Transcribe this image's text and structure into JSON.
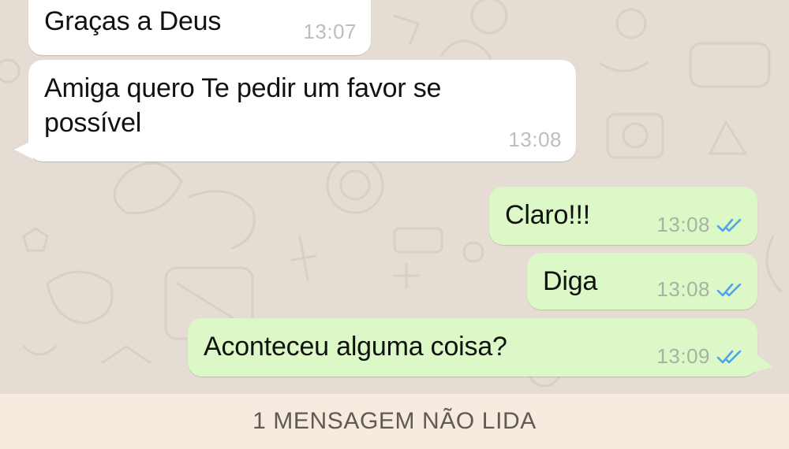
{
  "messages": [
    {
      "direction": "incoming",
      "text": "Graças a Deus",
      "time": "13:07"
    },
    {
      "direction": "incoming",
      "text_line1": "Amiga quero Te pedir um favor se",
      "text_line2": "possível",
      "time": "13:08"
    },
    {
      "direction": "outgoing",
      "text": "Claro!!!",
      "time": "13:08",
      "status": "read-double-check-icon"
    },
    {
      "direction": "outgoing",
      "text": "Diga",
      "time": "13:08",
      "status": "read-double-check-icon"
    },
    {
      "direction": "outgoing",
      "text": "Aconteceu alguma coisa?",
      "time": "13:09",
      "status": "read-double-check-icon"
    }
  ],
  "unread_banner": {
    "label": "1 MENSAGEM NÃO LIDA"
  },
  "colors": {
    "wallpaper": "#e5ddd3",
    "incoming_bubble": "#ffffff",
    "outgoing_bubble": "#dcf8c6",
    "read_check": "#4fa3e8",
    "banner": "#f6ebde"
  }
}
